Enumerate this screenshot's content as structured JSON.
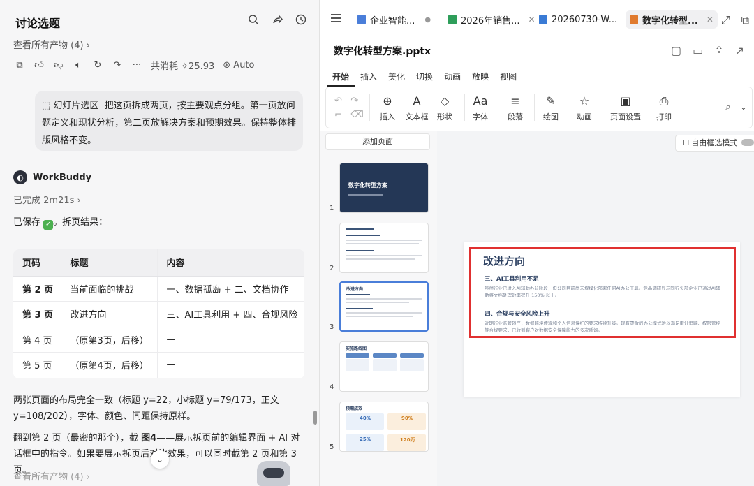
{
  "left": {
    "title": "讨论选题",
    "view_all": "查看所有产物 (4)",
    "consume_label": "共消耗",
    "consume_value": "25.93",
    "auto_label": "Auto",
    "prompt_tag": "幻灯片选区",
    "prompt_text": "把这页拆成两页，按主要观点分组。第一页放问题定义和现状分析，第二页放解决方案和预期效果。保持整体排版风格不变。",
    "agent_name": "WorkBuddy",
    "done_text": "已完成 2m21s",
    "saved_prefix": "已保存",
    "saved_suffix": "。拆页结果：",
    "table": {
      "headers": [
        "页码",
        "标题",
        "内容"
      ],
      "rows": [
        [
          "第 2 页",
          "当前面临的挑战",
          "一、数据孤岛 + 二、文档协作"
        ],
        [
          "第 3 页",
          "改进方向",
          "三、AI工具利用 + 四、合规风险"
        ],
        [
          "第 4 页",
          "（原第3页，后移）",
          "—"
        ],
        [
          "第 5 页",
          "（原第4页，后移）",
          "—"
        ]
      ]
    },
    "para1": "两张页面的布局完全一致（标题 y=22，小标题 y=79/173，正文 y=108/202），字体、颜色、间距保持原样。",
    "para2_a": "翻到第 2 页（最密的那个），截 ",
    "para2_b": "图4",
    "para2_c": "——展示拆页前的编辑界面 + AI 对话框中的指令。如果要展示拆页后对比效果，可以同时截第 2 页和第 3 页。",
    "view_all_bottom": "查看所有产物 (4)"
  },
  "tabs": [
    {
      "label": "企业智能...",
      "color": "#4a7ed9",
      "state": "dot"
    },
    {
      "label": "2026年销售...",
      "color": "#2e9e5a",
      "state": "close"
    },
    {
      "label": "20260730-W...",
      "color": "#3a7bd5",
      "state": "close"
    },
    {
      "label": "数字化转型...",
      "color": "#e07a2e",
      "state": "close"
    }
  ],
  "file_name": "数字化转型方案.pptx",
  "ribbon_tabs": [
    "开始",
    "插入",
    "美化",
    "切换",
    "动画",
    "放映",
    "视图"
  ],
  "ribbon_groups": [
    {
      "label": "插入",
      "icon": "⊕"
    },
    {
      "label": "文本框",
      "icon": "A"
    },
    {
      "label": "形状",
      "icon": "◇"
    },
    {
      "label": "字体",
      "icon": "Aa"
    },
    {
      "label": "段落",
      "icon": "≡"
    },
    {
      "label": "绘图",
      "icon": "✎"
    },
    {
      "label": "动画",
      "icon": "☆"
    },
    {
      "label": "页面设置",
      "icon": "▣"
    },
    {
      "label": "打印",
      "icon": "⎙"
    }
  ],
  "add_page": "添加页面",
  "select_mode": "自由框选模式",
  "slide_numbers": [
    "1",
    "2",
    "3",
    "4",
    "5"
  ],
  "thumb1_title": "数字化转型方案",
  "thumb3_title": "改进方向",
  "thumb4_title": "实施路线图",
  "thumb5_title": "预期成效",
  "thumb5_values": [
    "40%",
    "90%",
    "25%",
    "120万"
  ],
  "slide": {
    "title": "改进方向",
    "h1": "三、AI工具利用不足",
    "b1": "虽然行业已进入AI辅助办公阶段，但公司目前尚未规模化部署任何AI办公工具。竞品调研显示同行头部企业已通过AI辅助将文档处理效率提升 150% 以上。",
    "h2": "四、合规与安全风险上升",
    "b2": "近期行业监管趋严，数据跨境传输和个人信息保护的要求持续升级。现有零散的办公模式难以满足审计追踪、权限管控等合规要求，已收到客户对数据安全保障能力的多次质询。"
  }
}
